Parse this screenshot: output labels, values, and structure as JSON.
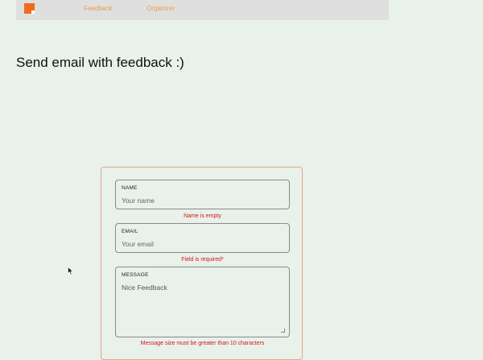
{
  "nav": {
    "feedback": "Feedback",
    "organizer": "Organizer"
  },
  "page": {
    "title": "Send email with feedback :)"
  },
  "form": {
    "name": {
      "label": "NAME",
      "placeholder": "Your name",
      "error": "Name is empty"
    },
    "email": {
      "label": "EMAIL",
      "placeholder": "Your email",
      "error": "Field is required*"
    },
    "message": {
      "label": "MESSAGE",
      "value": "Nice Feedback",
      "error": "Message size must be greater than 10 characters"
    }
  },
  "colors": {
    "accent": "#f26a1b",
    "link": "#e8a04b",
    "error": "#d4151b",
    "background": "#e8f1ea"
  }
}
